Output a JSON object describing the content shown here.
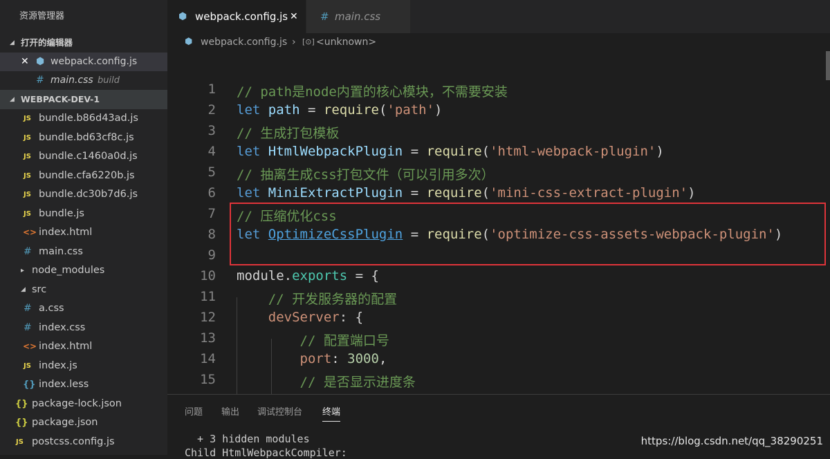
{
  "sidebar": {
    "title": "资源管理器",
    "open_editors_header": "打开的编辑器",
    "open_editors": [
      {
        "close": "✕",
        "name": "webpack.config.js",
        "suffix": ""
      },
      {
        "name": "main.css",
        "suffix": "build"
      }
    ],
    "project_header": "WEBPACK-DEV-1",
    "tree": [
      {
        "icon": "JS",
        "name": "bundle.b86d43ad.js"
      },
      {
        "icon": "JS",
        "name": "bundle.bd63cf8c.js"
      },
      {
        "icon": "JS",
        "name": "bundle.c1460a0d.js"
      },
      {
        "icon": "JS",
        "name": "bundle.cfa6220b.js"
      },
      {
        "icon": "JS",
        "name": "bundle.dc30b7d6.js"
      },
      {
        "icon": "JS",
        "name": "bundle.js"
      },
      {
        "icon": "<>",
        "name": "index.html"
      },
      {
        "icon": "#",
        "name": "main.css"
      },
      {
        "icon": "▸",
        "name": "node_modules"
      },
      {
        "icon": "◢",
        "name": "src"
      },
      {
        "icon": "#",
        "name": "a.css"
      },
      {
        "icon": "#",
        "name": "index.css"
      },
      {
        "icon": "<>",
        "name": "index.html"
      },
      {
        "icon": "JS",
        "name": "index.js"
      },
      {
        "icon": "{}",
        "name": "index.less"
      },
      {
        "icon": "{}",
        "name": "package-lock.json"
      },
      {
        "icon": "{}",
        "name": "package.json"
      },
      {
        "icon": "JS",
        "name": "postcss.config.js"
      }
    ]
  },
  "tabs": [
    {
      "label": "webpack.config.js",
      "close": "✕"
    },
    {
      "label": "main.css"
    }
  ],
  "breadcrumb": {
    "file": "webpack.config.js",
    "separator": "›",
    "symbol": "<unknown>"
  },
  "editor": {
    "line_numbers": [
      "1",
      "2",
      "3",
      "4",
      "5",
      "6",
      "7",
      "8",
      "9",
      "10",
      "11",
      "12",
      "13",
      "14",
      "15"
    ]
  },
  "panel": {
    "tabs": [
      "问题",
      "输出",
      "调试控制台",
      "终端"
    ],
    "terminal_lines": [
      "  + 3 hidden modules",
      "Child HtmlWebpackCompiler:"
    ]
  },
  "watermark": "https://blog.csdn.net/qq_38290251"
}
